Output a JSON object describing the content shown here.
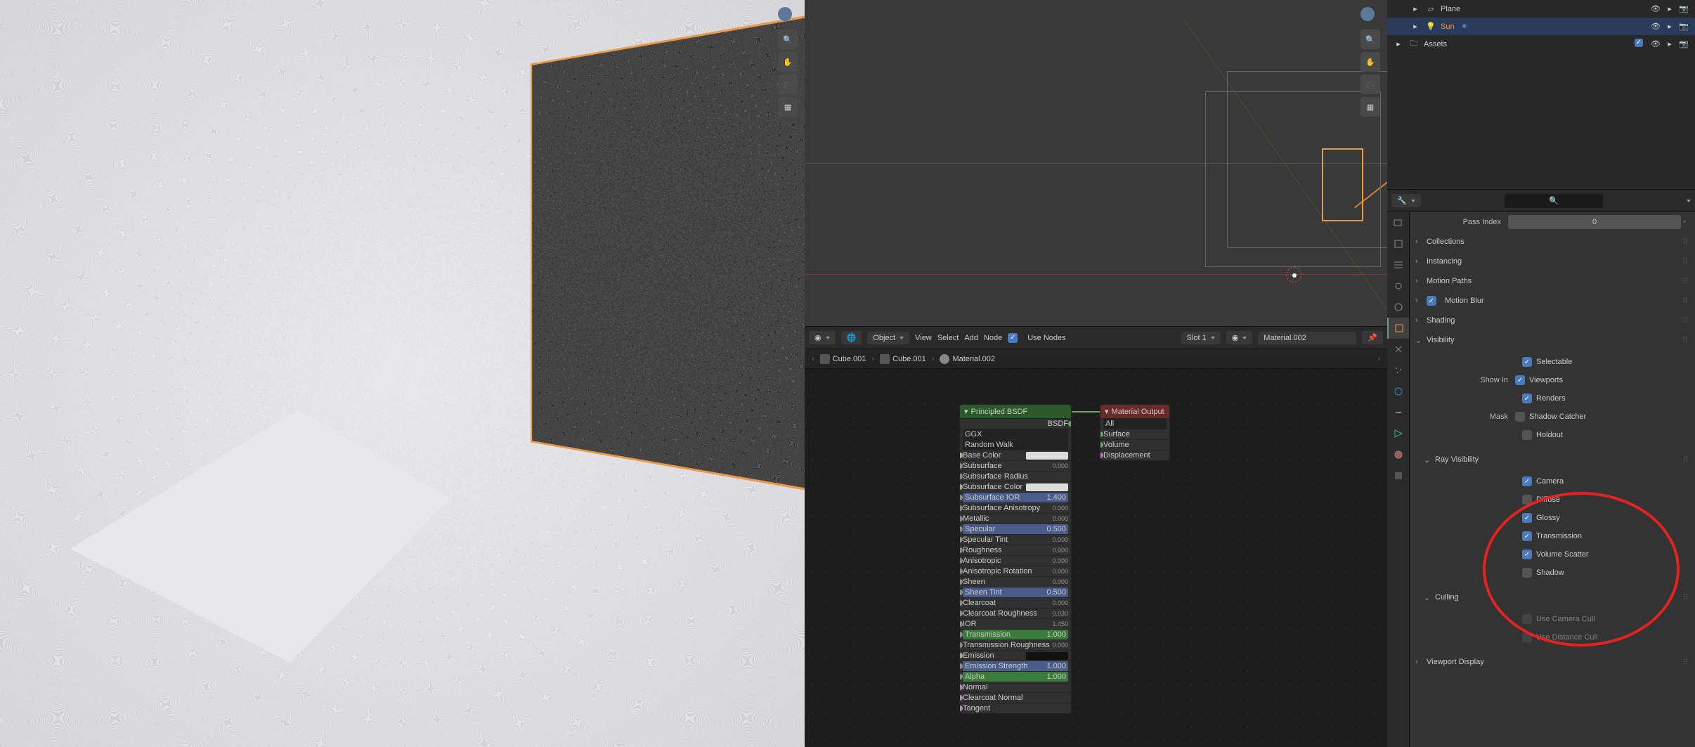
{
  "outliner": {
    "row0": {
      "name": "Plane"
    },
    "row1": {
      "name": "Sun"
    },
    "row2": {
      "name": "Assets"
    }
  },
  "props_header": {
    "search_placeholder": "🔍"
  },
  "pass_index": {
    "label": "Pass Index",
    "value": "0"
  },
  "panels": {
    "collections": "Collections",
    "instancing": "Instancing",
    "motion_paths": "Motion Paths",
    "motion_blur": "Motion Blur",
    "shading": "Shading",
    "visibility": "Visibility",
    "ray_visibility": "Ray Visibility",
    "culling": "Culling",
    "viewport_display": "Viewport Display"
  },
  "visibility": {
    "selectable": "Selectable",
    "show_in": "Show In",
    "viewports": "Viewports",
    "renders": "Renders",
    "mask": "Mask",
    "shadow_catcher": "Shadow Catcher",
    "holdout": "Holdout"
  },
  "ray": {
    "camera": "Camera",
    "diffuse": "Diffuse",
    "glossy": "Glossy",
    "transmission": "Transmission",
    "volume_scatter": "Volume Scatter",
    "shadow": "Shadow"
  },
  "culling": {
    "use_camera": "Use Camera Cull",
    "use_distance": "Use Distance Cull"
  },
  "node_editor": {
    "header": {
      "object_mode": "Object",
      "view": "View",
      "select": "Select",
      "add": "Add",
      "node": "Node",
      "use_nodes": "Use Nodes",
      "slot": "Slot 1",
      "material": "Material.002"
    },
    "breadcrumb": {
      "b1": "Cube.001",
      "b2": "Cube.001",
      "b3": "Material.002"
    }
  },
  "bsdf": {
    "title": "Principled BSDF",
    "bsdf": "BSDF",
    "dist": "GGX",
    "subsurf_method": "Random Walk",
    "base_color": "Base Color",
    "subsurface": "Subsurface",
    "subsurface_v": "0.000",
    "subsurface_radius": "Subsurface Radius",
    "subsurface_color": "Subsurface Color",
    "subsurface_ior": "Subsurface IOR",
    "subsurface_ior_v": "1.400",
    "subsurface_aniso": "Subsurface Anisotropy",
    "subsurface_aniso_v": "0.000",
    "metallic": "Metallic",
    "metallic_v": "0.000",
    "specular": "Specular",
    "specular_v": "0.500",
    "specular_tint": "Specular Tint",
    "specular_tint_v": "0.000",
    "roughness": "Roughness",
    "roughness_v": "0.000",
    "anisotropic": "Anisotropic",
    "anisotropic_v": "0.000",
    "aniso_rot": "Anisotropic Rotation",
    "aniso_rot_v": "0.000",
    "sheen": "Sheen",
    "sheen_v": "0.000",
    "sheen_tint": "Sheen Tint",
    "sheen_tint_v": "0.500",
    "clearcoat": "Clearcoat",
    "clearcoat_v": "0.000",
    "clearcoat_roughness": "Clearcoat Roughness",
    "clearcoat_roughness_v": "0.030",
    "ior": "IOR",
    "ior_v": "1.450",
    "transmission": "Transmission",
    "transmission_v": "1.000",
    "transmission_roughness": "Transmission Roughness",
    "transmission_roughness_v": "0.000",
    "emission": "Emission",
    "emission_strength": "Emission Strength",
    "emission_strength_v": "1.000",
    "alpha": "Alpha",
    "alpha_v": "1.000",
    "normal": "Normal",
    "clearcoat_normal": "Clearcoat Normal",
    "tangent": "Tangent"
  },
  "output": {
    "title": "Material Output",
    "target": "All",
    "surface": "Surface",
    "volume": "Volume",
    "displacement": "Displacement"
  }
}
